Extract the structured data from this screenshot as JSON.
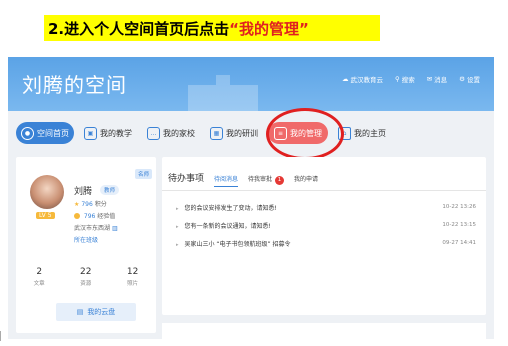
{
  "instruction": {
    "prefix": "2.进入个人空间首页后点击",
    "highlight": "“我的管理”"
  },
  "app": {
    "title": "刘腾的空间",
    "top_nav": [
      {
        "icon": "cloud-icon",
        "label": "武汉教育云"
      },
      {
        "icon": "search-icon",
        "label": "搜索"
      },
      {
        "icon": "mail-icon",
        "label": "消息"
      },
      {
        "icon": "gear-icon",
        "label": "设置"
      }
    ]
  },
  "tabs": [
    {
      "label": "空间首页",
      "icon": "user-icon"
    },
    {
      "label": "我的教学",
      "icon": "teach-icon"
    },
    {
      "label": "我的家校",
      "icon": "chat-icon"
    },
    {
      "label": "我的研训",
      "icon": "grid-icon"
    },
    {
      "label": "我的管理",
      "icon": "doc-icon"
    },
    {
      "label": "我的主页",
      "icon": "home-icon"
    }
  ],
  "profile": {
    "name": "刘腾",
    "tag": "教师",
    "level": "LV 5",
    "mentor_badge": "名师",
    "points_value": "796",
    "points_label": "积分",
    "exp_value": "796",
    "exp_label": "经验值",
    "school": "武汉市东西湖",
    "class_link": "所在班级",
    "stats": [
      {
        "value": "2",
        "label": "文章"
      },
      {
        "value": "22",
        "label": "资源"
      },
      {
        "value": "12",
        "label": "照片"
      }
    ],
    "cloud_label": "我的云盘"
  },
  "todo": {
    "title": "待办事项",
    "tabs": [
      {
        "label": "待阅消息",
        "active": true
      },
      {
        "label": "待我审批",
        "badge": "1"
      },
      {
        "label": "我的申请"
      }
    ],
    "messages": [
      {
        "text": "您的会议安排发生了变动，请知悉!",
        "time": "10-22 13:26"
      },
      {
        "text": "您有一条新的会议通知，请知悉!",
        "time": "10-22 13:15"
      },
      {
        "text": "吴家山三小 “电子书包领航班级” 招募令",
        "time": "09-27 14:41"
      }
    ]
  },
  "colors": {
    "accent": "#3a82d6",
    "highlight_tab": "#f06a6a",
    "annotation_red": "#e02020",
    "instruction_bg": "#ffff00"
  }
}
